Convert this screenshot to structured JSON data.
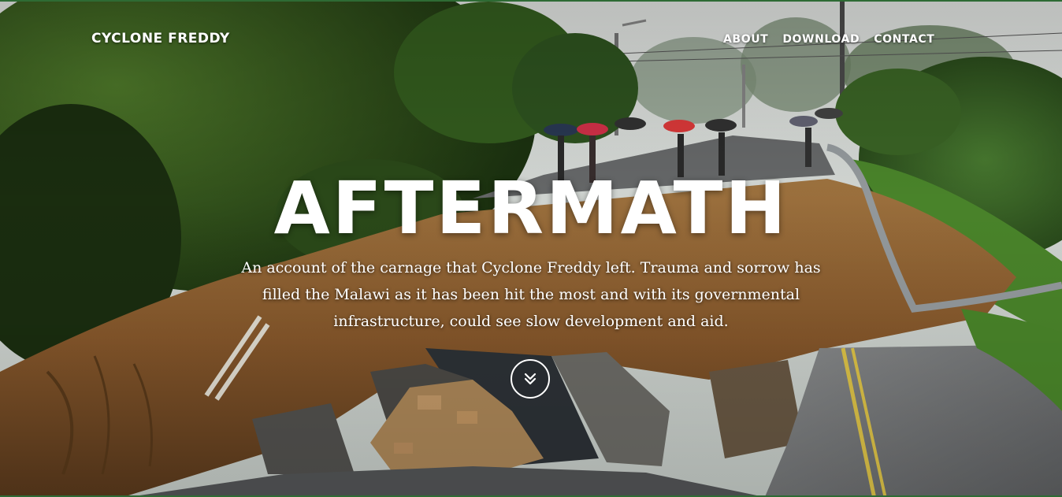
{
  "header": {
    "brand": "CYCLONE FREDDY",
    "nav": [
      {
        "label": "ABOUT"
      },
      {
        "label": "DOWNLOAD"
      },
      {
        "label": "CONTACT"
      }
    ]
  },
  "hero": {
    "title": "AFTERMATH",
    "lede": "An account of the carnage that Cyclone Freddy left. Trauma and sorrow has filled the Malawi as it has been hit the most and with its governmental infrastructure, could see slow development and aid.",
    "scroll_icon": "double-chevron-down-icon"
  },
  "colors": {
    "text": "#ffffff",
    "frame": "#2e6b34"
  }
}
